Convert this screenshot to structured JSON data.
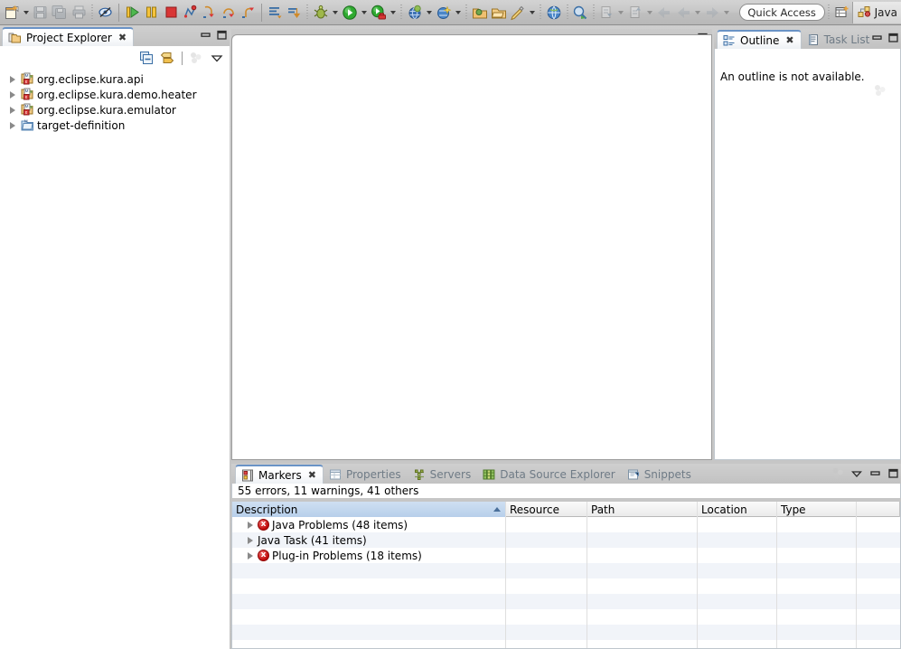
{
  "toolbar": {
    "groups": [
      {
        "name": "new",
        "items": [
          {
            "icon": "new-wizard-icon",
            "label": "New",
            "dropdown": true,
            "enabled": true
          },
          {
            "icon": "save-icon",
            "label": "Save",
            "enabled": false
          },
          {
            "icon": "save-all-icon",
            "label": "Save All",
            "enabled": false
          },
          {
            "icon": "print-icon",
            "label": "Print",
            "enabled": false
          }
        ]
      },
      {
        "name": "annotations",
        "items": [
          {
            "icon": "toggle-mark-occurrences-icon",
            "label": "Toggle Mark Occurrences",
            "enabled": true
          }
        ]
      },
      {
        "name": "debug",
        "items": [
          {
            "icon": "resume-icon",
            "label": "Resume",
            "enabled": true
          },
          {
            "icon": "suspend-icon",
            "label": "Suspend",
            "enabled": true
          },
          {
            "icon": "terminate-icon",
            "label": "Terminate",
            "enabled": true
          },
          {
            "icon": "disconnect-icon",
            "label": "Disconnect",
            "enabled": true
          },
          {
            "icon": "step-into-icon",
            "label": "Step Into",
            "enabled": true
          },
          {
            "icon": "step-over-icon",
            "label": "Step Over",
            "enabled": true
          },
          {
            "icon": "step-return-icon",
            "label": "Step Return",
            "enabled": true
          }
        ]
      },
      {
        "name": "console",
        "items": [
          {
            "icon": "next-annotation-icon",
            "label": "Next Annotation",
            "enabled": true
          },
          {
            "icon": "previous-annotation-icon",
            "label": "Previous Annotation",
            "enabled": true
          }
        ]
      },
      {
        "name": "launch",
        "items": [
          {
            "icon": "debug-icon",
            "label": "Debug",
            "dropdown": true,
            "enabled": true
          },
          {
            "icon": "run-icon",
            "label": "Run",
            "dropdown": true,
            "enabled": true
          },
          {
            "icon": "run-external-tools-icon",
            "label": "External Tools",
            "dropdown": true,
            "enabled": true
          }
        ]
      },
      {
        "name": "server",
        "items": [
          {
            "icon": "new-server-icon",
            "label": "New Server",
            "dropdown": true,
            "enabled": true
          },
          {
            "icon": "new-datasource-icon",
            "label": "New Data Source",
            "dropdown": true,
            "enabled": true
          }
        ]
      },
      {
        "name": "package",
        "items": [
          {
            "icon": "open-package-icon",
            "label": "Open Type",
            "enabled": true
          },
          {
            "icon": "open-folder-icon",
            "label": "Open Task",
            "enabled": true
          },
          {
            "icon": "new-java-project-icon",
            "label": "New Java Project",
            "dropdown": true,
            "enabled": true
          }
        ]
      },
      {
        "name": "web",
        "items": [
          {
            "icon": "web-browser-icon",
            "label": "Open Web Browser",
            "enabled": true
          },
          {
            "icon": "search-icon",
            "label": "Search",
            "enabled": true
          }
        ]
      },
      {
        "name": "navigate",
        "items": [
          {
            "icon": "next-edit-icon",
            "label": "Next Edit Location",
            "dropdown": true,
            "enabled": false
          },
          {
            "icon": "previous-edit-icon",
            "label": "Previous Edit Location",
            "dropdown": true,
            "enabled": false
          },
          {
            "icon": "back-history-icon",
            "label": "Back",
            "enabled": false
          },
          {
            "icon": "back-icon",
            "label": "Back To",
            "dropdown": true,
            "enabled": false
          },
          {
            "icon": "forward-icon",
            "label": "Forward",
            "dropdown": true,
            "enabled": false
          }
        ]
      }
    ],
    "quick_access": {
      "placeholder": "Quick Access",
      "value": "Quick Access"
    },
    "open_perspective_label": "Open Perspective",
    "perspective": {
      "label": "Java",
      "icon": "java-perspective-icon"
    }
  },
  "explorer": {
    "tab": {
      "label": "Project Explorer",
      "icon": "project-explorer-icon",
      "close": "✖"
    },
    "view_tools": [
      {
        "name": "minimize-button",
        "icon": "minimize-icon"
      },
      {
        "name": "maximize-button",
        "icon": "maximize-icon"
      }
    ],
    "toolbar": [
      {
        "name": "collapse-all-button",
        "icon": "collapse-all-icon"
      },
      {
        "name": "link-with-editor-button",
        "icon": "link-with-editor-icon"
      },
      {
        "name": "view-menu-button",
        "icon": "view-menu-icon"
      }
    ],
    "projects": [
      {
        "label": "org.eclipse.kura.api",
        "icon": "java-project-error-icon",
        "expanded": false
      },
      {
        "label": "org.eclipse.kura.demo.heater",
        "icon": "java-project-error-icon",
        "expanded": false
      },
      {
        "label": "org.eclipse.kura.emulator",
        "icon": "java-project-error-icon",
        "expanded": false
      },
      {
        "label": "target-definition",
        "icon": "project-folder-icon",
        "expanded": false
      }
    ]
  },
  "editor": {
    "empty": true,
    "view_tools": [
      {
        "name": "minimize-button",
        "icon": "minimize-icon"
      },
      {
        "name": "maximize-button",
        "icon": "maximize-icon"
      }
    ]
  },
  "outline": {
    "tabs": [
      {
        "label": "Outline",
        "icon": "outline-icon",
        "active": true,
        "close": "✖"
      },
      {
        "label": "Task List",
        "icon": "task-list-icon",
        "active": false
      }
    ],
    "message": "An outline is not available.",
    "view_tools": [
      {
        "name": "minimize-button",
        "icon": "minimize-icon"
      },
      {
        "name": "maximize-button",
        "icon": "maximize-icon"
      }
    ],
    "body_tool": {
      "name": "view-menu-button",
      "icon": "view-menu-icon"
    }
  },
  "markers": {
    "tabs": [
      {
        "label": "Markers",
        "icon": "markers-icon",
        "active": true,
        "close": "✖"
      },
      {
        "label": "Properties",
        "icon": "properties-icon",
        "active": false
      },
      {
        "label": "Servers",
        "icon": "servers-icon",
        "active": false
      },
      {
        "label": "Data Source Explorer",
        "icon": "data-source-explorer-icon",
        "active": false
      },
      {
        "label": "Snippets",
        "icon": "snippets-icon",
        "active": false
      }
    ],
    "summary": "55 errors, 11 warnings, 41 others",
    "view_tools": [
      {
        "name": "view-menu-button",
        "icon": "view-menu-icon"
      },
      {
        "name": "minimize-button",
        "icon": "minimize-icon"
      },
      {
        "name": "maximize-button",
        "icon": "maximize-icon"
      }
    ],
    "grouping_tool": {
      "name": "group-by-button",
      "icon": "group-by-icon"
    },
    "columns": [
      {
        "label": "Description",
        "sorted": true,
        "sort_direction": "asc"
      },
      {
        "label": "Resource",
        "sorted": false
      },
      {
        "label": "Path",
        "sorted": false
      },
      {
        "label": "Location",
        "sorted": false
      },
      {
        "label": "Type",
        "sorted": false
      }
    ],
    "rows": [
      {
        "description": "Java Problems (48 items)",
        "severity": "error",
        "expanded": false,
        "resource": "",
        "path": "",
        "location": "",
        "type": ""
      },
      {
        "description": "Java Task (41 items)",
        "severity": "none",
        "expanded": false,
        "resource": "",
        "path": "",
        "location": "",
        "type": ""
      },
      {
        "description": "Plug-in Problems (18 items)",
        "severity": "error",
        "expanded": false,
        "resource": "",
        "path": "",
        "location": "",
        "type": ""
      }
    ],
    "empty_row_count": 6
  },
  "colors": {
    "accent_tab_top": "#6a93c6",
    "error_red": "#c00808",
    "row_alt": "#f1f4f9",
    "chrome": "#c8c8c8",
    "sorted_header": "#b7cfea"
  }
}
